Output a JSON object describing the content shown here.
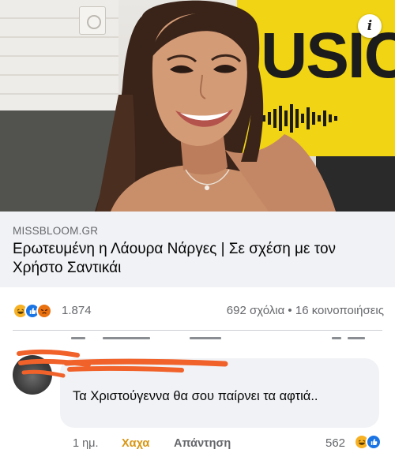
{
  "link_preview": {
    "image_alt": "photo-woman-smiling-radio-studio",
    "poster_text": "USIC",
    "info_icon": "info-icon",
    "domain": "MISSBLOOM.GR",
    "headline": "Ερωτευμένη η Λάουρα Νάργες | Σε σχέση με τον Χρήστο Σαντικάι"
  },
  "reactions": {
    "icons": [
      "haha-reaction-icon",
      "like-reaction-icon",
      "angry-reaction-icon"
    ],
    "count": "1.874",
    "stats": "692 σχόλια • 16 κοινοποιήσεις"
  },
  "comment": {
    "text": "Τα Χριστούγεννα θα σου παίρνει τα αφτιά..",
    "time": "1 ημ.",
    "haha_label": "Χαχα",
    "reply_label": "Απάντηση",
    "reaction_count": "562",
    "reaction_icons": [
      "haha-reaction-icon",
      "like-reaction-icon"
    ]
  },
  "colors": {
    "haha": "#f7b125",
    "like": "#1b74e4",
    "angry": "#e9710f",
    "scribble": "#f0622a",
    "secondary_text": "#65676b",
    "bubble": "#f0f2f5"
  }
}
